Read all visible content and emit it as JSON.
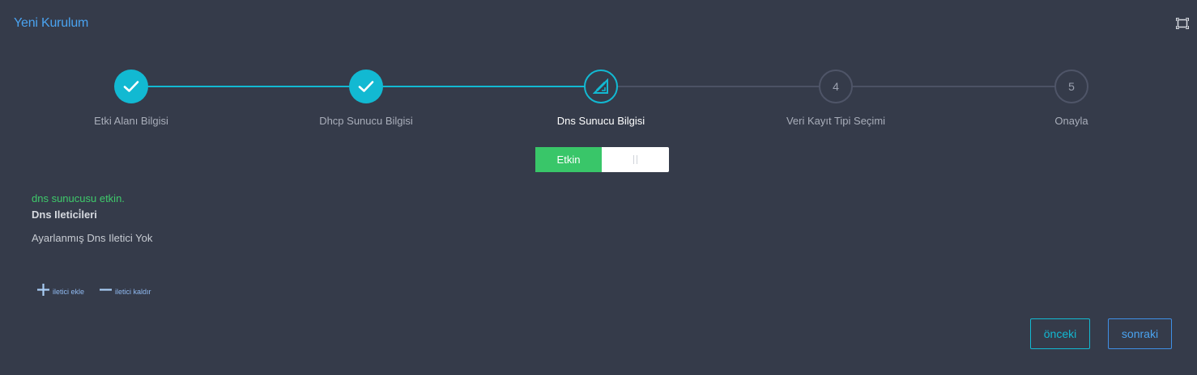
{
  "window": {
    "title": "Yeni Kurulum",
    "maximize_icon": "maximize-icon"
  },
  "stepper": {
    "steps": [
      {
        "label": "Etki Alanı Bilgisi",
        "state": "done",
        "icon": "check-icon"
      },
      {
        "label": "Dhcp Sunucu Bilgisi",
        "state": "done",
        "icon": "check-icon"
      },
      {
        "label": "Dns Sunucu Bilgisi",
        "state": "active",
        "icon": "pencil-ruler-icon"
      },
      {
        "label": "Veri Kayıt Tipi Seçimi",
        "state": "todo",
        "number": "4"
      },
      {
        "label": "Onayla",
        "state": "todo",
        "number": "5"
      }
    ]
  },
  "toggle": {
    "on_label": "Etkin",
    "state": "on"
  },
  "dns": {
    "status": "dns sunucusu etkin.",
    "forwarders_title": "Dns Iletici̇leri",
    "empty_message": "Ayarlanmış Dns Iletici Yok"
  },
  "actions": {
    "add_label": "iletici ekle",
    "remove_label": "iletici kaldır"
  },
  "buttons": {
    "prev": "önceki",
    "next": "sonraki"
  },
  "colors": {
    "accent": "#12b9d2",
    "success": "#39c669",
    "link": "#4aa3f0",
    "background": "#353b4a"
  }
}
